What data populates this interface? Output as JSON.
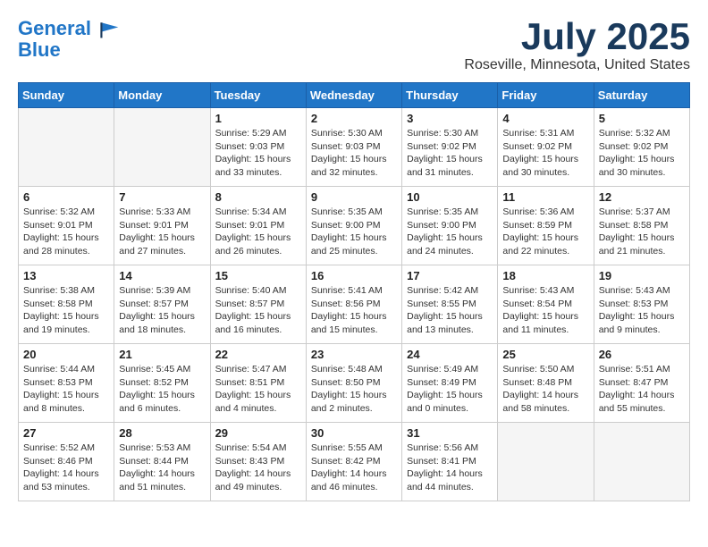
{
  "header": {
    "logo_line1": "General",
    "logo_line2": "Blue",
    "month_title": "July 2025",
    "location": "Roseville, Minnesota, United States"
  },
  "days_of_week": [
    "Sunday",
    "Monday",
    "Tuesday",
    "Wednesday",
    "Thursday",
    "Friday",
    "Saturday"
  ],
  "weeks": [
    [
      {
        "num": "",
        "empty": true
      },
      {
        "num": "",
        "empty": true
      },
      {
        "num": "1",
        "sunrise": "5:29 AM",
        "sunset": "9:03 PM",
        "daylight": "15 hours and 33 minutes."
      },
      {
        "num": "2",
        "sunrise": "5:30 AM",
        "sunset": "9:03 PM",
        "daylight": "15 hours and 32 minutes."
      },
      {
        "num": "3",
        "sunrise": "5:30 AM",
        "sunset": "9:02 PM",
        "daylight": "15 hours and 31 minutes."
      },
      {
        "num": "4",
        "sunrise": "5:31 AM",
        "sunset": "9:02 PM",
        "daylight": "15 hours and 30 minutes."
      },
      {
        "num": "5",
        "sunrise": "5:32 AM",
        "sunset": "9:02 PM",
        "daylight": "15 hours and 30 minutes."
      }
    ],
    [
      {
        "num": "6",
        "sunrise": "5:32 AM",
        "sunset": "9:01 PM",
        "daylight": "15 hours and 28 minutes."
      },
      {
        "num": "7",
        "sunrise": "5:33 AM",
        "sunset": "9:01 PM",
        "daylight": "15 hours and 27 minutes."
      },
      {
        "num": "8",
        "sunrise": "5:34 AM",
        "sunset": "9:01 PM",
        "daylight": "15 hours and 26 minutes."
      },
      {
        "num": "9",
        "sunrise": "5:35 AM",
        "sunset": "9:00 PM",
        "daylight": "15 hours and 25 minutes."
      },
      {
        "num": "10",
        "sunrise": "5:35 AM",
        "sunset": "9:00 PM",
        "daylight": "15 hours and 24 minutes."
      },
      {
        "num": "11",
        "sunrise": "5:36 AM",
        "sunset": "8:59 PM",
        "daylight": "15 hours and 22 minutes."
      },
      {
        "num": "12",
        "sunrise": "5:37 AM",
        "sunset": "8:58 PM",
        "daylight": "15 hours and 21 minutes."
      }
    ],
    [
      {
        "num": "13",
        "sunrise": "5:38 AM",
        "sunset": "8:58 PM",
        "daylight": "15 hours and 19 minutes."
      },
      {
        "num": "14",
        "sunrise": "5:39 AM",
        "sunset": "8:57 PM",
        "daylight": "15 hours and 18 minutes."
      },
      {
        "num": "15",
        "sunrise": "5:40 AM",
        "sunset": "8:57 PM",
        "daylight": "15 hours and 16 minutes."
      },
      {
        "num": "16",
        "sunrise": "5:41 AM",
        "sunset": "8:56 PM",
        "daylight": "15 hours and 15 minutes."
      },
      {
        "num": "17",
        "sunrise": "5:42 AM",
        "sunset": "8:55 PM",
        "daylight": "15 hours and 13 minutes."
      },
      {
        "num": "18",
        "sunrise": "5:43 AM",
        "sunset": "8:54 PM",
        "daylight": "15 hours and 11 minutes."
      },
      {
        "num": "19",
        "sunrise": "5:43 AM",
        "sunset": "8:53 PM",
        "daylight": "15 hours and 9 minutes."
      }
    ],
    [
      {
        "num": "20",
        "sunrise": "5:44 AM",
        "sunset": "8:53 PM",
        "daylight": "15 hours and 8 minutes."
      },
      {
        "num": "21",
        "sunrise": "5:45 AM",
        "sunset": "8:52 PM",
        "daylight": "15 hours and 6 minutes."
      },
      {
        "num": "22",
        "sunrise": "5:47 AM",
        "sunset": "8:51 PM",
        "daylight": "15 hours and 4 minutes."
      },
      {
        "num": "23",
        "sunrise": "5:48 AM",
        "sunset": "8:50 PM",
        "daylight": "15 hours and 2 minutes."
      },
      {
        "num": "24",
        "sunrise": "5:49 AM",
        "sunset": "8:49 PM",
        "daylight": "15 hours and 0 minutes."
      },
      {
        "num": "25",
        "sunrise": "5:50 AM",
        "sunset": "8:48 PM",
        "daylight": "14 hours and 58 minutes."
      },
      {
        "num": "26",
        "sunrise": "5:51 AM",
        "sunset": "8:47 PM",
        "daylight": "14 hours and 55 minutes."
      }
    ],
    [
      {
        "num": "27",
        "sunrise": "5:52 AM",
        "sunset": "8:46 PM",
        "daylight": "14 hours and 53 minutes."
      },
      {
        "num": "28",
        "sunrise": "5:53 AM",
        "sunset": "8:44 PM",
        "daylight": "14 hours and 51 minutes."
      },
      {
        "num": "29",
        "sunrise": "5:54 AM",
        "sunset": "8:43 PM",
        "daylight": "14 hours and 49 minutes."
      },
      {
        "num": "30",
        "sunrise": "5:55 AM",
        "sunset": "8:42 PM",
        "daylight": "14 hours and 46 minutes."
      },
      {
        "num": "31",
        "sunrise": "5:56 AM",
        "sunset": "8:41 PM",
        "daylight": "14 hours and 44 minutes."
      },
      {
        "num": "",
        "empty": true
      },
      {
        "num": "",
        "empty": true
      }
    ]
  ]
}
